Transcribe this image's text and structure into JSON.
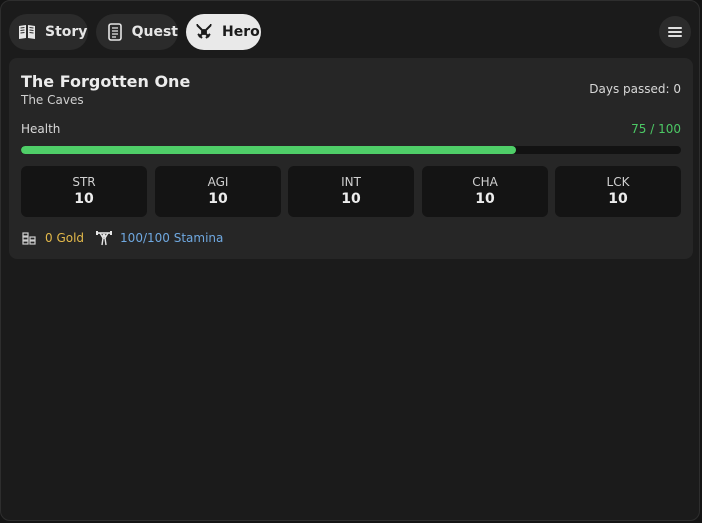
{
  "tabs": [
    {
      "label": "Story",
      "icon": "book-icon",
      "active": false
    },
    {
      "label": "Quest",
      "icon": "scroll-icon",
      "active": false
    },
    {
      "label": "Hero",
      "icon": "crossed-swords-icon",
      "active": true
    }
  ],
  "menu": {
    "icon": "hamburger-menu-icon"
  },
  "hero": {
    "name": "The Forgotten One",
    "location": "The Caves",
    "days_label": "Days passed: 0"
  },
  "health": {
    "label": "Health",
    "current": 75,
    "max": 100,
    "display": "75 / 100",
    "color": "#4fce68"
  },
  "stats": [
    {
      "abbr": "STR",
      "value": "10"
    },
    {
      "abbr": "AGI",
      "value": "10"
    },
    {
      "abbr": "INT",
      "value": "10"
    },
    {
      "abbr": "CHA",
      "value": "10"
    },
    {
      "abbr": "LCK",
      "value": "10"
    }
  ],
  "resources": {
    "gold": {
      "text": "0 Gold",
      "icon": "coin-stack-icon",
      "color": "#e3b94a"
    },
    "stamina": {
      "text": "100/100 Stamina",
      "icon": "weightlifter-icon",
      "color": "#6fa8e0"
    }
  }
}
